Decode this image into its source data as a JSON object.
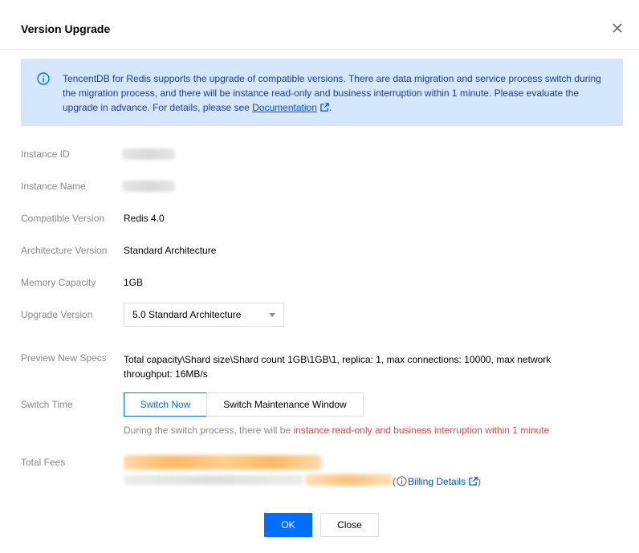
{
  "dialog": {
    "title": "Version Upgrade",
    "close_icon": "close-icon"
  },
  "notice": {
    "icon": "info-icon",
    "text": "TencentDB for Redis supports the upgrade of compatible versions. There are data migration and service process switch during the migration process, and there will be instance read-only and business interruption within 1 minute. Please evaluate the upgrade in advance. For details, please see ",
    "link_label": "Documentation",
    "link_icon": "external-link-icon",
    "suffix": "."
  },
  "fields": {
    "instance_id_label": "Instance ID",
    "instance_name_label": "Instance Name",
    "compatible_version_label": "Compatible Version",
    "compatible_version_value": "Redis 4.0",
    "architecture_version_label": "Architecture Version",
    "architecture_version_value": "Standard Architecture",
    "memory_capacity_label": "Memory Capacity",
    "memory_capacity_value": "1GB",
    "upgrade_version_label": "Upgrade Version",
    "upgrade_version_value": "5.0 Standard Architecture",
    "preview_specs_label": "Preview New Specs",
    "preview_specs_value": "Total capacity\\Shard size\\Shard count 1GB\\1GB\\1, replica: 1, max connections: 10000, max network throughput: 16MB/s",
    "switch_time_label": "Switch Time",
    "switch_now_label": "Switch Now",
    "switch_maintenance_label": "Switch Maintenance Window",
    "switch_note_prefix": "During the switch process, there will be ",
    "switch_note_warning": "instance read-only and business interruption within 1 minute",
    "total_fees_label": "Total Fees",
    "billing_open_paren": "(",
    "billing_label": "Billing Details",
    "billing_close_paren": ")"
  },
  "footer": {
    "ok_label": "OK",
    "close_label": "Close"
  },
  "colors": {
    "primary": "#006eff",
    "notice_bg": "#d5e7fd",
    "warning": "#e54545"
  }
}
